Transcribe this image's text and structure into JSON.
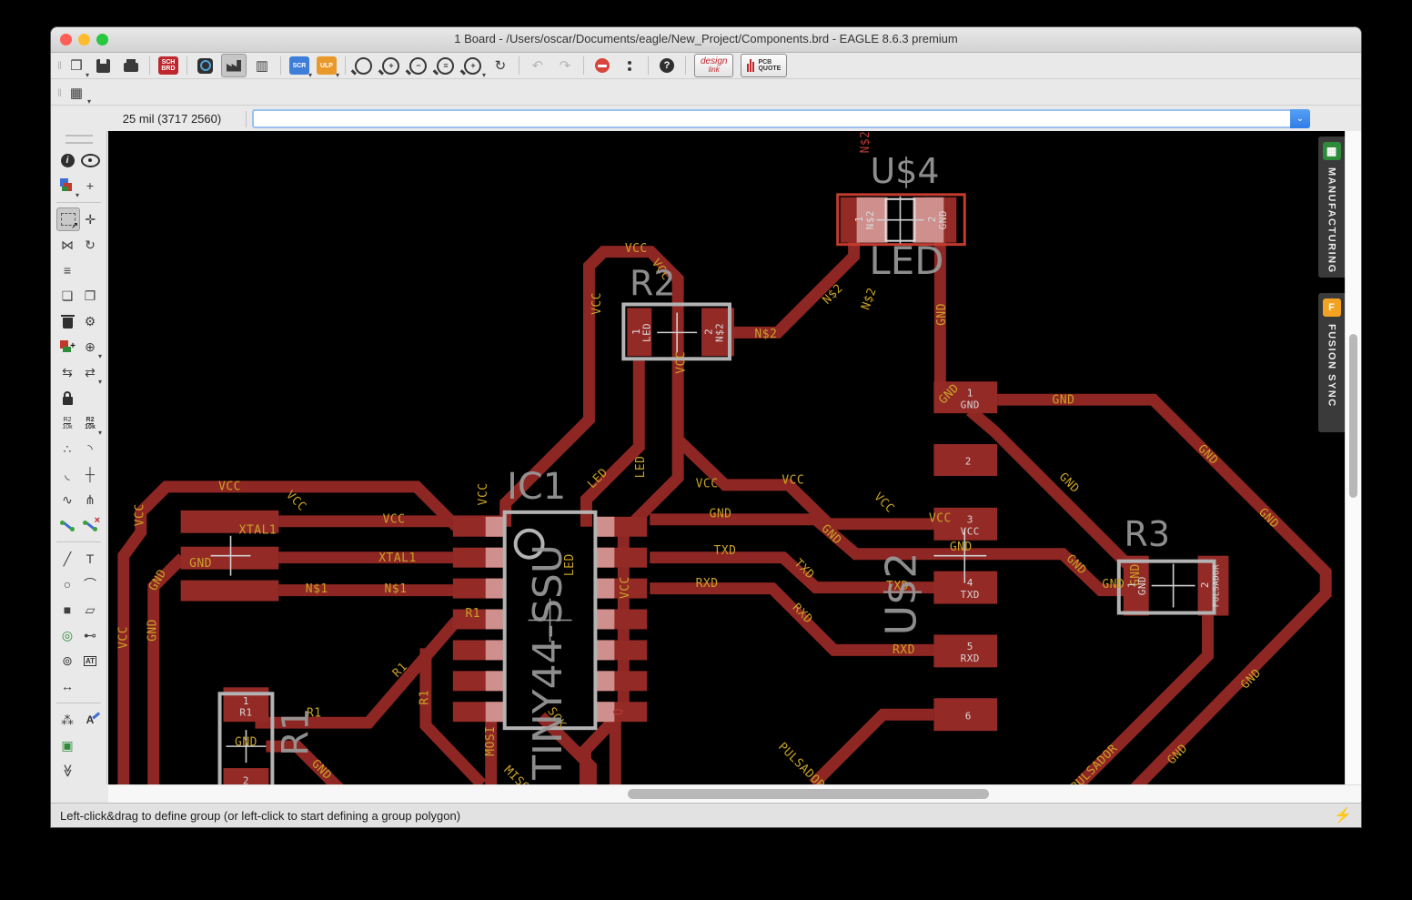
{
  "window": {
    "title": "1 Board - /Users/oscar/Documents/eagle/New_Project/Components.brd - EAGLE 8.6.3 premium",
    "traffic_lights": [
      "#ff5f57",
      "#febc2e",
      "#28c840"
    ]
  },
  "toolbar": {
    "items": [
      {
        "n": "open-file-button",
        "k": "g",
        "g": "❒",
        "dd": 1
      },
      {
        "n": "save-button",
        "k": "floppy"
      },
      {
        "n": "print-button",
        "k": "printer"
      },
      {
        "n": "sep1",
        "k": "sep"
      },
      {
        "n": "schematic-board-switch",
        "k": "box",
        "cls": "red",
        "t": [
          "SCH",
          "BRD"
        ]
      },
      {
        "n": "sep2",
        "k": "sep"
      },
      {
        "n": "a360-button",
        "k": "a360"
      },
      {
        "n": "fabrication-view-button",
        "k": "fab",
        "sel": 1
      },
      {
        "n": "layer-columns-button",
        "k": "g",
        "g": "▥"
      },
      {
        "n": "sep3",
        "k": "sep"
      },
      {
        "n": "run-script-button",
        "k": "box",
        "cls": "blue",
        "t": [
          "SCR"
        ],
        "dd": 1
      },
      {
        "n": "run-ulp-button",
        "k": "box",
        "cls": "orange",
        "t": [
          "ULP"
        ],
        "dd": 1
      },
      {
        "n": "sep4",
        "k": "sep"
      },
      {
        "n": "zoom-fit-button",
        "k": "mag",
        "g": ""
      },
      {
        "n": "zoom-in-button",
        "k": "mag",
        "g": "+"
      },
      {
        "n": "zoom-out-button",
        "k": "mag",
        "g": "−"
      },
      {
        "n": "zoom-redraw-button",
        "k": "mag",
        "g": "≡"
      },
      {
        "n": "zoom-select-button",
        "k": "mag",
        "g": "+",
        "dd": 1
      },
      {
        "n": "refresh-button",
        "k": "g",
        "g": "↻"
      },
      {
        "n": "sep5",
        "k": "sep"
      },
      {
        "n": "undo-button",
        "k": "g",
        "g": "↶",
        "dis": 1
      },
      {
        "n": "redo-button",
        "k": "g",
        "g": "↷",
        "dis": 1
      },
      {
        "n": "sep6",
        "k": "sep"
      },
      {
        "n": "stop-button",
        "k": "stop"
      },
      {
        "n": "go-button",
        "k": "dots2"
      },
      {
        "n": "sep7",
        "k": "sep"
      },
      {
        "n": "help-button",
        "k": "help"
      }
    ],
    "design_link_label": [
      "design",
      "link"
    ],
    "pcb_quote_label": [
      "PCB",
      "QUOTE"
    ]
  },
  "gridrow": {
    "grid_button_glyph": "▦"
  },
  "coordrow": {
    "coords": "25 mil (3717 2560)",
    "command_value": "",
    "command_placeholder": ""
  },
  "sidebar": {
    "rows": [
      [
        {
          "n": "info-tool",
          "k": "circ",
          "g": "i"
        },
        {
          "n": "eye-tool",
          "k": "eye"
        }
      ],
      [
        {
          "n": "layer-settings-tool",
          "k": "layersq",
          "dd": 1
        },
        {
          "n": "origin-mark-tool",
          "k": "g",
          "g": "+"
        }
      ],
      "sep",
      [
        {
          "n": "group-select-tool",
          "k": "dashedbox",
          "sel": 1
        },
        {
          "n": "move-tool",
          "k": "g",
          "g": "✛"
        }
      ],
      [
        {
          "n": "mirror-tool",
          "k": "g",
          "g": "⋈"
        },
        {
          "n": "rotate-tool",
          "k": "g",
          "g": "↻"
        }
      ],
      [
        {
          "n": "align-tool",
          "k": "g",
          "g": "≡"
        },
        null
      ],
      [
        {
          "n": "copy-tool",
          "k": "g",
          "g": "❏"
        },
        {
          "n": "paste-tool",
          "k": "g",
          "g": "❐"
        }
      ],
      [
        {
          "n": "delete-tool",
          "k": "trash"
        },
        {
          "n": "change-tool",
          "k": "g",
          "g": "⚙"
        }
      ],
      [
        {
          "n": "add-part-tool",
          "k": "addpart"
        },
        {
          "n": "invoke-tool",
          "k": "g",
          "g": "⊕",
          "dd": 1
        }
      ],
      [
        {
          "n": "pinswap-tool",
          "k": "g",
          "g": "⇆"
        },
        {
          "n": "replace-tool",
          "k": "g",
          "g": "⇄",
          "dd": 1
        }
      ],
      [
        {
          "n": "lock-tool",
          "k": "lock"
        },
        null
      ],
      [
        {
          "n": "name-tool",
          "k": "txt2",
          "t": [
            "R2",
            "10k"
          ]
        },
        {
          "n": "value-tool",
          "k": "txt2b",
          "t": [
            "R2",
            "10k"
          ],
          "dd": 1
        }
      ],
      [
        {
          "n": "smash-tool",
          "k": "g",
          "g": "∴"
        },
        {
          "n": "miter-tool",
          "k": "g",
          "g": "◝"
        }
      ],
      [
        {
          "n": "unmiter-tool",
          "k": "g",
          "g": "◟"
        },
        {
          "n": "optimize-tool",
          "k": "g",
          "g": "┼"
        }
      ],
      [
        {
          "n": "meander-tool",
          "k": "g",
          "g": "∿"
        },
        {
          "n": "split-tool",
          "k": "g",
          "g": "⋔"
        }
      ],
      [
        {
          "n": "route-tool",
          "k": "routeseg"
        },
        {
          "n": "ripup-tool",
          "k": "ripup"
        }
      ],
      "sep",
      [
        {
          "n": "wire-tool",
          "k": "g",
          "g": "╱"
        },
        {
          "n": "text-tool",
          "k": "g",
          "g": "T"
        }
      ],
      [
        {
          "n": "circle-tool",
          "k": "g",
          "g": "○"
        },
        {
          "n": "arc-tool",
          "k": "g",
          "g": "⌒"
        }
      ],
      [
        {
          "n": "rect-tool",
          "k": "g",
          "g": "■"
        },
        {
          "n": "polygon-tool",
          "k": "g",
          "g": "▱"
        }
      ],
      [
        {
          "n": "via-tool",
          "k": "g",
          "g": "◎",
          "cls": "green"
        },
        {
          "n": "signal-tool",
          "k": "g",
          "g": "⊷"
        }
      ],
      [
        {
          "n": "hole-tool",
          "k": "g",
          "g": "⊚"
        },
        {
          "n": "attribute-tool",
          "k": "txt1",
          "t": [
            "AT"
          ]
        }
      ],
      [
        {
          "n": "measure-tool",
          "k": "g",
          "g": "↔"
        },
        null
      ],
      "sep",
      [
        {
          "n": "ratsnest-tool",
          "k": "g",
          "g": "⁂"
        },
        {
          "n": "autoroute-tool",
          "k": "auto",
          "g": "A"
        }
      ],
      [
        {
          "n": "drc-tool",
          "k": "g",
          "g": "▣",
          "cls": "green"
        },
        null
      ],
      [
        {
          "n": "more-tools-chevron",
          "k": "g",
          "g": "≫",
          "cls": "rot90",
          "span": 1
        },
        null
      ]
    ]
  },
  "tabs": [
    {
      "n": "tab-manufacturing",
      "label": "MANUFACTURING",
      "icon": "chip-icon",
      "icon_glyph": "▦",
      "icon_color": "green"
    },
    {
      "n": "tab-fusion-sync",
      "label": "FUSION SYNC",
      "icon": "fusion-icon",
      "icon_glyph": "F",
      "icon_color": "orange"
    }
  ],
  "statusbar": {
    "text": "Left-click&drag to define group (or left-click to start defining a group polygon)",
    "bolt_glyph": "⚡"
  },
  "canvas": {
    "colors": {
      "trace": "#8e2723",
      "pad": "#932a26",
      "pink": "#cf8f8d",
      "outline_gray": "#b3b3b3",
      "outline_red": "#c23b2e",
      "label_yellow": "#c9a227",
      "label_white": "#d8d8d8",
      "label_gray": "#9a9a9a",
      "label_red": "#b23b35",
      "bg": "#000000"
    },
    "components": [
      "U$4 LED",
      "R2",
      "IC1 TINY44-SSU",
      "U$2",
      "R3",
      "R1"
    ],
    "labels": [
      [
        "VCC",
        132,
        392,
        0,
        "y"
      ],
      [
        "VCC",
        205,
        408,
        45,
        "y"
      ],
      [
        "VCC",
        33,
        423,
        -90,
        "y"
      ],
      [
        "VCC",
        412,
        400,
        -90,
        "y"
      ],
      [
        "VCC",
        15,
        558,
        -90,
        "y"
      ],
      [
        "GND",
        47,
        550,
        -90,
        "y"
      ],
      [
        "GND",
        53,
        495,
        -60,
        "y"
      ],
      [
        "XTAL1",
        163,
        440,
        0,
        "y"
      ],
      [
        "GND",
        100,
        477,
        0,
        "y"
      ],
      [
        "N$1",
        228,
        505,
        0,
        "y"
      ],
      [
        "N$1",
        315,
        505,
        0,
        "y"
      ],
      [
        "VCC",
        313,
        428,
        0,
        "y"
      ],
      [
        "XTAL1",
        317,
        471,
        0,
        "y"
      ],
      [
        "VCC",
        580,
        130,
        0,
        "y"
      ],
      [
        "VCC",
        607,
        153,
        55,
        "y"
      ],
      [
        "VCC",
        537,
        190,
        -90,
        "y"
      ],
      [
        "VCC",
        630,
        255,
        -90,
        "y"
      ],
      [
        "VCC",
        568,
        503,
        -90,
        "y"
      ],
      [
        "LED",
        585,
        370,
        -90,
        "y"
      ],
      [
        "LED",
        538,
        383,
        -45,
        "y"
      ],
      [
        "LED",
        507,
        478,
        -90,
        "y"
      ],
      [
        "N$2",
        723,
        224,
        0,
        "y"
      ],
      [
        "N$2",
        797,
        180,
        -45,
        "y"
      ],
      [
        "N$2",
        837,
        185,
        -70,
        "y"
      ],
      [
        "N$2",
        833,
        12,
        -90,
        "r"
      ],
      [
        "GND",
        917,
        202,
        -90,
        "y"
      ],
      [
        "GND",
        925,
        290,
        -45,
        "y"
      ],
      [
        "GND",
        1051,
        297,
        0,
        "y"
      ],
      [
        "GND",
        1210,
        357,
        45,
        "y"
      ],
      [
        "GND",
        1277,
        427,
        45,
        "y"
      ],
      [
        "GND",
        1258,
        604,
        -45,
        "y"
      ],
      [
        "GND",
        1177,
        687,
        -45,
        "y"
      ],
      [
        "GND",
        1057,
        388,
        45,
        "y"
      ],
      [
        "GND",
        673,
        422,
        0,
        "y"
      ],
      [
        "GND",
        795,
        445,
        45,
        "y"
      ],
      [
        "GND",
        938,
        459,
        0,
        "y"
      ],
      [
        "GND",
        1065,
        478,
        45,
        "y"
      ],
      [
        "GND",
        1106,
        500,
        0,
        "y"
      ],
      [
        "GND",
        1131,
        489,
        -90,
        "y"
      ],
      [
        "TXD",
        678,
        463,
        0,
        "y"
      ],
      [
        "TXD",
        765,
        483,
        45,
        "y"
      ],
      [
        "TXD",
        868,
        502,
        0,
        "y"
      ],
      [
        "RXD",
        658,
        499,
        0,
        "y"
      ],
      [
        "RXD",
        763,
        532,
        45,
        "y"
      ],
      [
        "RXD",
        875,
        572,
        0,
        "y"
      ],
      [
        "VCC",
        658,
        389,
        0,
        "y"
      ],
      [
        "VCC",
        753,
        385,
        0,
        "y"
      ],
      [
        "VCC",
        853,
        410,
        45,
        "y"
      ],
      [
        "VCC",
        915,
        427,
        0,
        "y"
      ],
      [
        "R1",
        400,
        532,
        0,
        "y"
      ],
      [
        "R1",
        320,
        594,
        -45,
        "y"
      ],
      [
        "R1",
        347,
        624,
        -90,
        "y"
      ],
      [
        "R1",
        225,
        642,
        0,
        "y"
      ],
      [
        "GND",
        150,
        674,
        0,
        "y"
      ],
      [
        "GND",
        233,
        704,
        45,
        "y"
      ],
      [
        "MOSI",
        420,
        672,
        -90,
        "y"
      ],
      [
        "SCK",
        492,
        647,
        55,
        "y"
      ],
      [
        "Q",
        561,
        640,
        -90,
        "r"
      ],
      [
        "MISO",
        448,
        714,
        45,
        "y"
      ],
      [
        "PULSADOR",
        762,
        700,
        45,
        "y"
      ],
      [
        "PULSADOR",
        1085,
        702,
        -45,
        "y"
      ],
      [
        "1",
        826,
        97,
        -90,
        "w"
      ],
      [
        "N$2",
        838,
        98,
        -90,
        "w"
      ],
      [
        "2",
        906,
        97,
        -90,
        "w"
      ],
      [
        "GND",
        918,
        98,
        -90,
        "w"
      ],
      [
        "1",
        580,
        221,
        -90,
        "w"
      ],
      [
        "LED",
        592,
        222,
        -90,
        "w"
      ],
      [
        "2",
        660,
        221,
        -90,
        "w"
      ],
      [
        "N$2",
        672,
        222,
        -90,
        "w"
      ],
      [
        "1",
        1126,
        500,
        -90,
        "w"
      ],
      [
        "GND",
        1138,
        501,
        -90,
        "w"
      ],
      [
        "2",
        1207,
        500,
        -90,
        "w"
      ],
      [
        "PULSADOR",
        1220,
        501,
        -90,
        "w",
        9
      ],
      [
        "1",
        150,
        628,
        0,
        "w"
      ],
      [
        "R1",
        150,
        641,
        0,
        "w"
      ],
      [
        "2",
        150,
        716,
        0,
        "w"
      ],
      [
        "1",
        948,
        289,
        0,
        "w"
      ],
      [
        "GND",
        948,
        302,
        0,
        "w"
      ],
      [
        "2",
        946,
        364,
        0,
        "w"
      ],
      [
        "3",
        948,
        428,
        0,
        "w"
      ],
      [
        "VCC",
        948,
        441,
        0,
        "w"
      ],
      [
        "4",
        948,
        498,
        0,
        "w"
      ],
      [
        "TXD",
        948,
        511,
        0,
        "w"
      ],
      [
        "5",
        948,
        568,
        0,
        "w"
      ],
      [
        "RXD",
        948,
        581,
        0,
        "w"
      ],
      [
        "6",
        946,
        645,
        0,
        "w"
      ],
      [
        "U$4",
        876,
        44,
        0,
        "g",
        38
      ],
      [
        "LED",
        878,
        143,
        0,
        "g",
        42
      ],
      [
        "R2",
        598,
        168,
        0,
        "g",
        38
      ],
      [
        "IC1",
        470,
        392,
        0,
        "g",
        40
      ],
      [
        "TINY44-SSU",
        483,
        585,
        -90,
        "g",
        44
      ],
      [
        "U$2",
        872,
        510,
        -90,
        "g",
        46
      ],
      [
        "R3",
        1143,
        444,
        0,
        "g",
        38
      ],
      [
        "R1",
        205,
        662,
        -90,
        "g",
        40
      ]
    ]
  }
}
